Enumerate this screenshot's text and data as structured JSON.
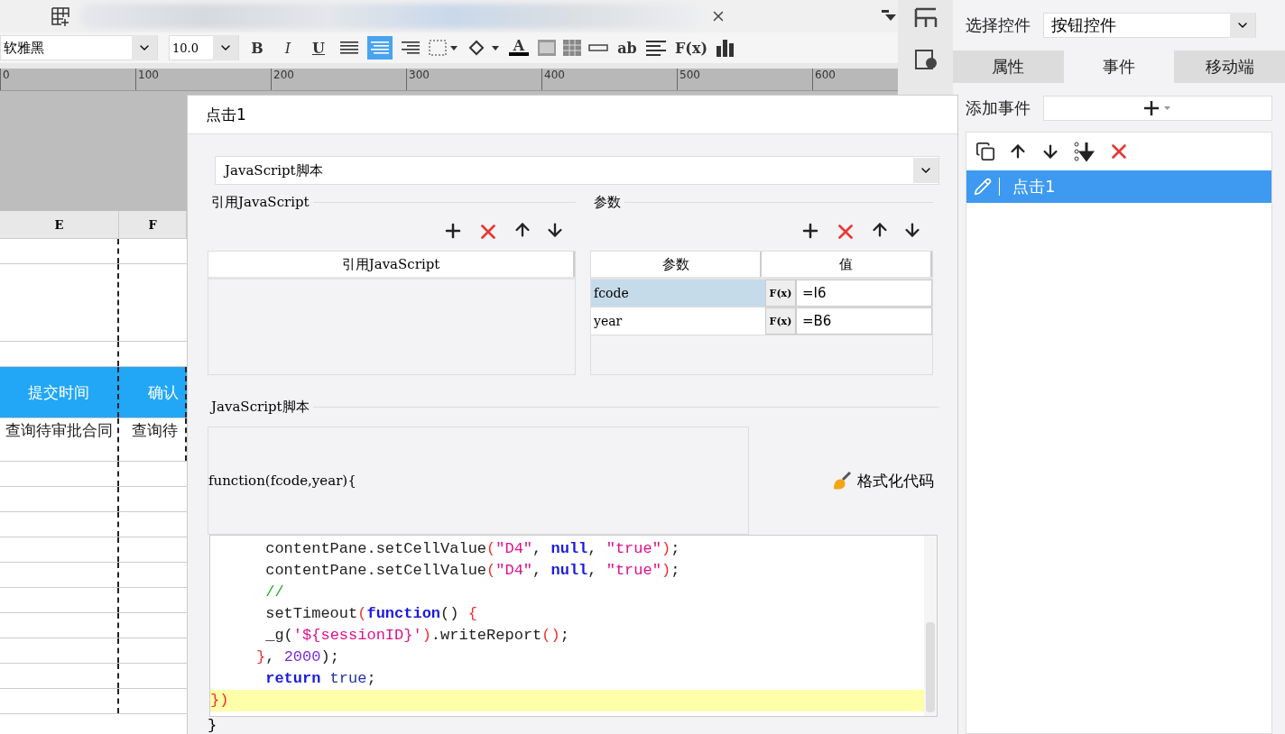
{
  "toolbar": {
    "font_family": "软雅黑",
    "font_size": "10.0",
    "tools": [
      {
        "kind": "bold",
        "label": "B"
      },
      {
        "kind": "italic",
        "label": "I"
      },
      {
        "kind": "underline",
        "label": "U"
      },
      {
        "kind": "align-left",
        "selected": false
      },
      {
        "kind": "align-center",
        "selected": true
      },
      {
        "kind": "align-right",
        "selected": false
      },
      {
        "kind": "border"
      },
      {
        "kind": "fill"
      },
      {
        "kind": "font-color",
        "label": "A"
      },
      {
        "kind": "merge"
      },
      {
        "kind": "split"
      },
      {
        "kind": "field"
      },
      {
        "kind": "text",
        "label": "ab"
      },
      {
        "kind": "lines"
      },
      {
        "kind": "text",
        "label": "F(x)"
      },
      {
        "kind": "chart"
      }
    ]
  },
  "ruler": {
    "ticks": [
      "0",
      "100",
      "200",
      "300",
      "400",
      "500",
      "600"
    ]
  },
  "sheet": {
    "columns": [
      "E",
      "F"
    ],
    "header_cells": [
      "提交时间",
      "确认"
    ],
    "data_cells": [
      "查询待审批合同",
      "查询待"
    ]
  },
  "dialog": {
    "title": "点击1",
    "type_select": "JavaScript脚本",
    "reference": {
      "title": "引用JavaScript",
      "column": "引用JavaScript"
    },
    "params": {
      "title": "参数",
      "columns": [
        "参数",
        "值"
      ],
      "rows": [
        {
          "name": "fcode",
          "formula": "F(x)",
          "value": "=I6",
          "selected": true
        },
        {
          "name": "year",
          "formula": "F(x)",
          "value": "=B6",
          "selected": false
        }
      ]
    },
    "script": {
      "title": "JavaScript脚本",
      "signature": "function(fcode,year){",
      "format_button": "格式化代码",
      "closing": "}",
      "code_lines": [
        {
          "current": false,
          "tokens": [
            {
              "kind": "plain",
              "text": "      contentPane.setCellValue"
            },
            {
              "kind": "paren",
              "text": "("
            },
            {
              "kind": "string",
              "text": "\"D4\""
            },
            {
              "kind": "plain",
              "text": ", "
            },
            {
              "kind": "keyword",
              "text": "null"
            },
            {
              "kind": "plain",
              "text": ", "
            },
            {
              "kind": "string",
              "text": "\"true\""
            },
            {
              "kind": "paren",
              "text": ")"
            },
            {
              "kind": "plain",
              "text": ";"
            }
          ]
        },
        {
          "current": false,
          "tokens": [
            {
              "kind": "plain",
              "text": "      contentPane.setCellValue"
            },
            {
              "kind": "paren",
              "text": "("
            },
            {
              "kind": "string",
              "text": "\"D4\""
            },
            {
              "kind": "plain",
              "text": ", "
            },
            {
              "kind": "keyword",
              "text": "null"
            },
            {
              "kind": "plain",
              "text": ", "
            },
            {
              "kind": "string",
              "text": "\"true\""
            },
            {
              "kind": "paren",
              "text": ")"
            },
            {
              "kind": "plain",
              "text": ";"
            }
          ]
        },
        {
          "current": false,
          "tokens": [
            {
              "kind": "comment",
              "text": "      //"
            }
          ]
        },
        {
          "current": false,
          "tokens": [
            {
              "kind": "plain",
              "text": "      setTimeout"
            },
            {
              "kind": "paren",
              "text": "("
            },
            {
              "kind": "keyword",
              "text": "function"
            },
            {
              "kind": "plain",
              "text": "() "
            },
            {
              "kind": "paren",
              "text": "{"
            }
          ]
        },
        {
          "current": false,
          "tokens": [
            {
              "kind": "plain",
              "text": "      _g("
            },
            {
              "kind": "string",
              "text": "'${sessionID}'"
            },
            {
              "kind": "paren",
              "text": ")"
            },
            {
              "kind": "plain",
              "text": ".writeReport"
            },
            {
              "kind": "paren",
              "text": "()"
            },
            {
              "kind": "plain",
              "text": ";"
            }
          ]
        },
        {
          "current": false,
          "tokens": [
            {
              "kind": "paren",
              "text": "     }"
            },
            {
              "kind": "plain",
              "text": ", "
            },
            {
              "kind": "number",
              "text": "2000"
            },
            {
              "kind": "plain",
              "text": ");"
            }
          ]
        },
        {
          "current": false,
          "tokens": [
            {
              "kind": "keyword",
              "text": "      return"
            },
            {
              "kind": "atom",
              "text": " true"
            },
            {
              "kind": "plain",
              "text": ";"
            }
          ]
        },
        {
          "current": true,
          "tokens": [
            {
              "kind": "paren",
              "text": "})"
            }
          ]
        }
      ]
    }
  },
  "side_panel": {
    "select_label": "选择控件",
    "select_value": "按钮控件",
    "tabs": [
      {
        "label": "属性",
        "selected": false
      },
      {
        "label": "事件",
        "selected": true
      },
      {
        "label": "移动端",
        "selected": false
      }
    ],
    "add_event_label": "添加事件",
    "events": [
      {
        "label": "点击1",
        "selected": true
      }
    ]
  }
}
